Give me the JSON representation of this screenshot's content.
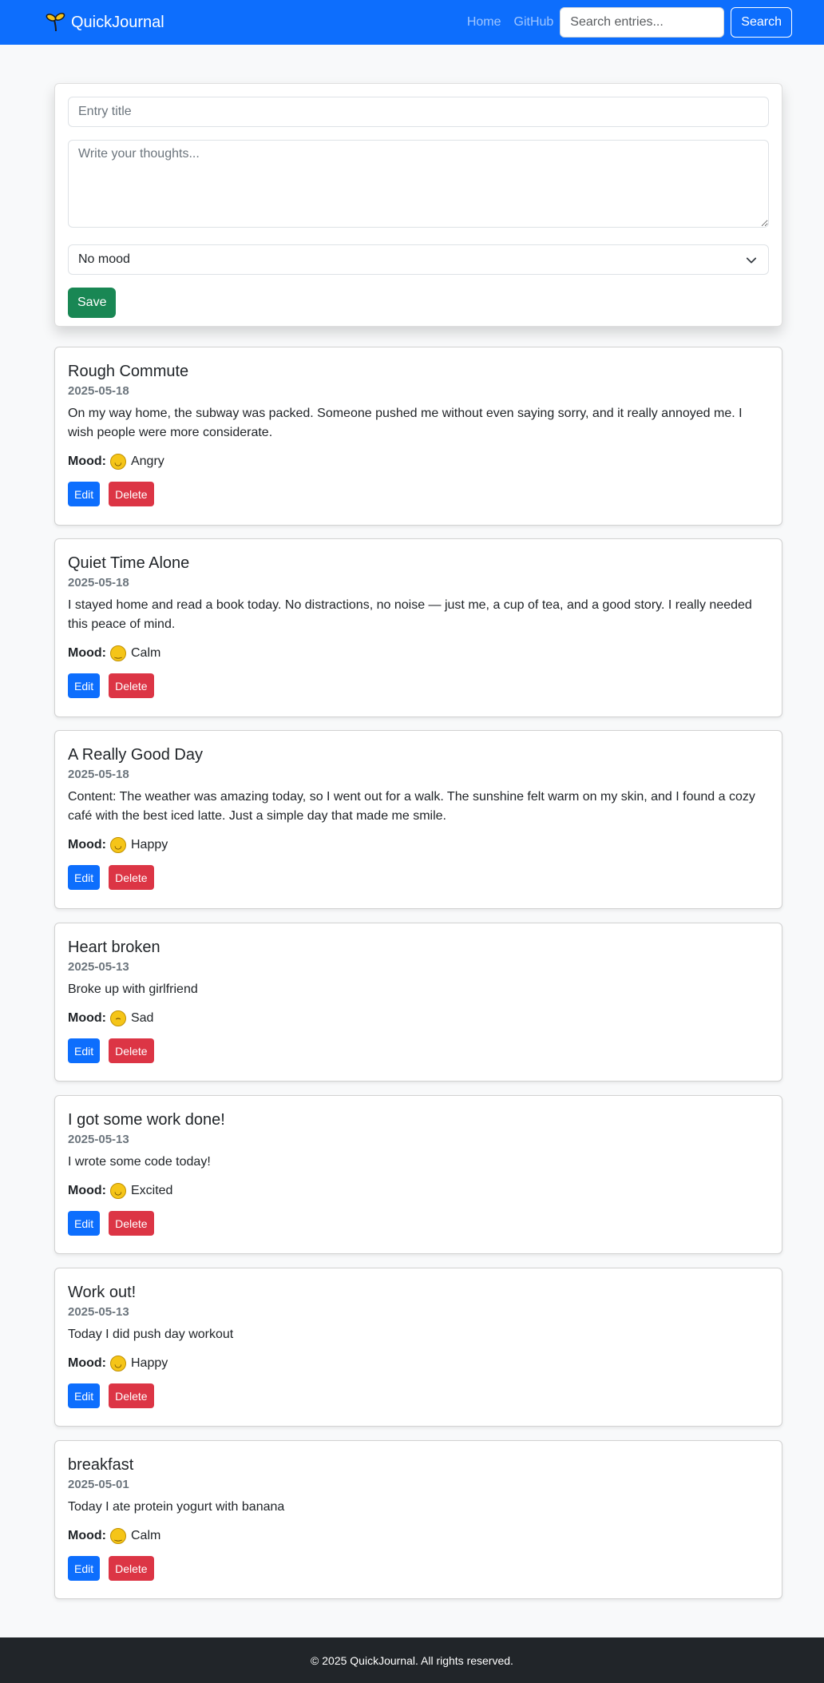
{
  "navbar": {
    "brand": "QuickJournal",
    "links": [
      "Home",
      "GitHub"
    ],
    "search_placeholder": "Search entries...",
    "search_button": "Search",
    "colors": {
      "primary": "#0d6efd"
    }
  },
  "form": {
    "title_placeholder": "Entry title",
    "content_placeholder": "Write your thoughts...",
    "mood_selected": "No mood",
    "save_label": "Save"
  },
  "entries": [
    {
      "title": "Rough Commute",
      "date": "2025-05-18",
      "content": "On my way home, the subway was packed. Someone pushed me without even saying sorry, and it really annoyed me. I wish people were more considerate.",
      "mood_label": "Mood:",
      "mood": "Angry",
      "mood_icon": "angry-face",
      "edit_label": "Edit",
      "delete_label": "Delete"
    },
    {
      "title": "Quiet Time Alone",
      "date": "2025-05-18",
      "content": "I stayed home and read a book today. No distractions, no noise — just me, a cup of tea, and a good story. I really needed this peace of mind.",
      "mood_label": "Mood:",
      "mood": "Calm",
      "mood_icon": "calm-face",
      "edit_label": "Edit",
      "delete_label": "Delete"
    },
    {
      "title": "A Really Good Day",
      "date": "2025-05-18",
      "content": "Content: The weather was amazing today, so I went out for a walk. The sunshine felt warm on my skin, and I found a cozy café with the best iced latte. Just a simple day that made me smile.",
      "mood_label": "Mood:",
      "mood": "Happy",
      "mood_icon": "happy-face",
      "edit_label": "Edit",
      "delete_label": "Delete"
    },
    {
      "title": "Heart broken",
      "date": "2025-05-13",
      "content": "Broke up with girlfriend",
      "mood_label": "Mood:",
      "mood": "Sad",
      "mood_icon": "sad-face",
      "edit_label": "Edit",
      "delete_label": "Delete"
    },
    {
      "title": "I got some work done!",
      "date": "2025-05-13",
      "content": "I wrote some code today!",
      "mood_label": "Mood:",
      "mood": "Excited",
      "mood_icon": "excited-face",
      "edit_label": "Edit",
      "delete_label": "Delete"
    },
    {
      "title": "Work out!",
      "date": "2025-05-13",
      "content": "Today I did push day workout",
      "mood_label": "Mood:",
      "mood": "Happy",
      "mood_icon": "happy-face",
      "edit_label": "Edit",
      "delete_label": "Delete"
    },
    {
      "title": "breakfast",
      "date": "2025-05-01",
      "content": "Today I ate protein yogurt with banana",
      "mood_label": "Mood:",
      "mood": "Calm",
      "mood_icon": "calm-face",
      "edit_label": "Edit",
      "delete_label": "Delete"
    }
  ],
  "footer": {
    "text": "© 2025 QuickJournal. All rights reserved."
  }
}
